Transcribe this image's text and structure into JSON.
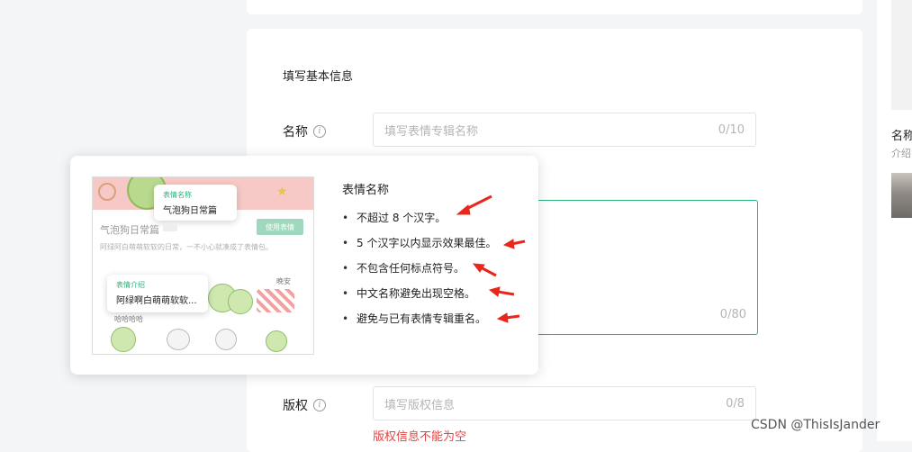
{
  "form": {
    "section_title": "填写基本信息",
    "name": {
      "label": "名称",
      "placeholder": "填写表情专辑名称",
      "counter": "0/10"
    },
    "intro": {
      "counter": "0/80"
    },
    "copyright": {
      "label": "版权",
      "placeholder": "填写版权信息",
      "counter": "0/8",
      "error": "版权信息不能为空"
    },
    "info_icon": "i"
  },
  "popover": {
    "preview": {
      "tip_name_title": "表情名称",
      "tip_name_value": "气泡狗日常篇",
      "album_name": "气泡狗日常篇",
      "use_button": "使用表情",
      "desc": "阿绿阿白萌萌软软的日常，一不小心就凑成了表情包。",
      "tip_intro_title": "表情介绍",
      "tip_intro_value": "阿绿啊白萌萌软软...",
      "sticker_caption1": "晚安",
      "sticker_caption2": "哈哈哈哈"
    },
    "rules_title": "表情名称",
    "rules": [
      "不超过 8 个汉字。",
      "5 个汉字以内显示效果最佳。",
      "不包含任何标点符号。",
      "中文名称避免出现空格。",
      "避免与已有表情专辑重名。"
    ],
    "bullet": "•",
    "arrow_color": "#e8261c"
  },
  "right_panel": {
    "name": "名称",
    "intro": "介绍"
  },
  "watermark": "CSDN @ThisIsJander"
}
